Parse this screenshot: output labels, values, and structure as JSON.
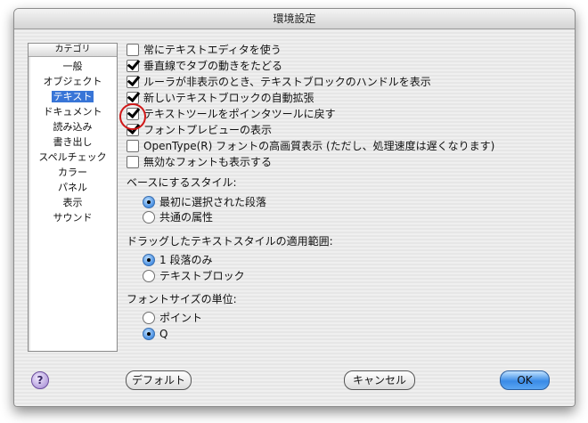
{
  "window": {
    "title": "環境設定"
  },
  "sidebar": {
    "header": "カテゴリ",
    "items": [
      {
        "label": "一般"
      },
      {
        "label": "オブジェクト"
      },
      {
        "label": "テキスト"
      },
      {
        "label": "ドキュメント"
      },
      {
        "label": "読み込み"
      },
      {
        "label": "書き出し"
      },
      {
        "label": "スペルチェック"
      },
      {
        "label": "カラー"
      },
      {
        "label": "パネル"
      },
      {
        "label": "表示"
      },
      {
        "label": "サウンド"
      }
    ],
    "selected": "テキスト"
  },
  "options": [
    {
      "label": "常にテキストエディタを使う",
      "checked": false
    },
    {
      "label": "垂直線でタブの動きをたどる",
      "checked": true
    },
    {
      "label": "ルーラが非表示のとき、テキストブロックのハンドルを表示",
      "checked": true
    },
    {
      "label": "新しいテキストブロックの自動拡張",
      "checked": true
    },
    {
      "label": "テキストツールをポインタツールに戻す",
      "checked": true
    },
    {
      "label": "フォントプレビューの表示",
      "checked": true
    },
    {
      "label": "OpenType(R) フォントの高画質表示 (ただし、処理速度は遅くなります)",
      "checked": false
    },
    {
      "label": "無効なフォントも表示する",
      "checked": false
    }
  ],
  "base_style": {
    "label": "ベースにするスタイル:",
    "choices": [
      "最初に選択された段落",
      "共通の属性"
    ],
    "selected": "最初に選択された段落"
  },
  "drag_scope": {
    "label": "ドラッグしたテキストスタイルの適用範囲:",
    "choices": [
      "1 段落のみ",
      "テキストブロック"
    ],
    "selected": "1 段落のみ"
  },
  "font_size_unit": {
    "label": "フォントサイズの単位:",
    "choices": [
      "ポイント",
      "Q"
    ],
    "selected": "Q"
  },
  "buttons": {
    "help": "?",
    "default": "デフォルト",
    "cancel": "キャンセル",
    "ok": "OK"
  },
  "colors": {
    "selection": "#3875d7",
    "ok_button": "#3a8be6",
    "annotation_circle": "#d01818"
  }
}
